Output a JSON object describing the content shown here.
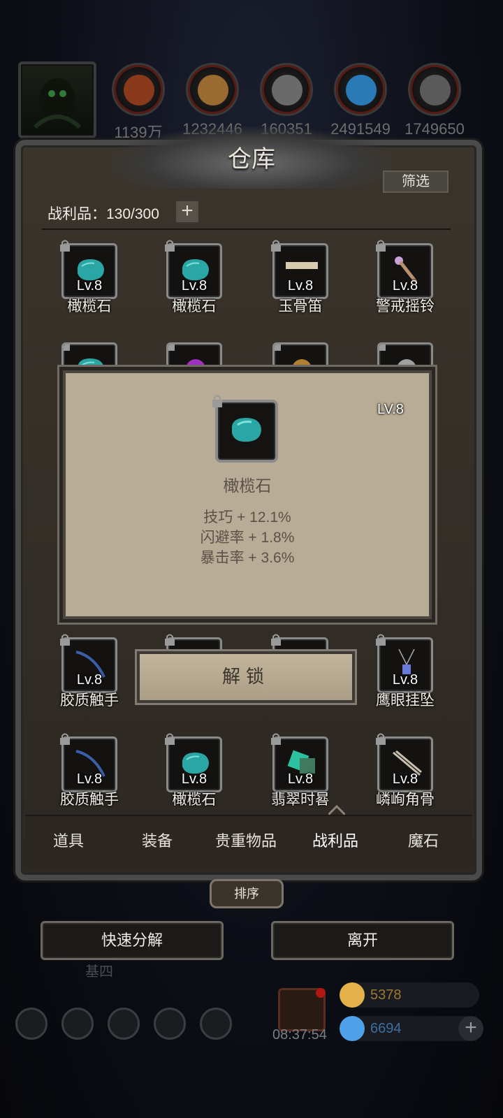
{
  "resources": [
    {
      "name": "copper-ore",
      "count": "1139万",
      "color": "#8a3a1a"
    },
    {
      "name": "wood-planks",
      "count": "1232446",
      "color": "#9a6a30"
    },
    {
      "name": "stone-blocks",
      "count": "160351",
      "color": "#6a6a6a"
    },
    {
      "name": "blue-crystal",
      "count": "2491549",
      "color": "#2a7ab8"
    },
    {
      "name": "iron-ingots",
      "count": "1749650",
      "color": "#5a5a5a"
    }
  ],
  "window": {
    "title": "仓库",
    "filter_label": "筛选"
  },
  "capacity": {
    "label": "战利品：130/300",
    "plus": "+"
  },
  "items": [
    {
      "name": "橄榄石",
      "level": "Lv.8",
      "art": "olivine"
    },
    {
      "name": "橄榄石",
      "level": "Lv.8",
      "art": "olivine"
    },
    {
      "name": "玉骨笛",
      "level": "Lv.8",
      "art": "bone-flute"
    },
    {
      "name": "警戒摇铃",
      "level": "Lv.8",
      "art": "bell"
    },
    {
      "name": "胶质触手",
      "level": "Lv.8",
      "art": "tentacle"
    },
    {
      "name": "",
      "level": "",
      "art": "fish-partial"
    },
    {
      "name": "",
      "level": "",
      "art": "hidden"
    },
    {
      "name": "鹰眼挂坠",
      "level": "Lv.8",
      "art": "pendant"
    },
    {
      "name": "胶质触手",
      "level": "Lv.8",
      "art": "tentacle"
    },
    {
      "name": "橄榄石",
      "level": "Lv.8",
      "art": "olivine"
    },
    {
      "name": "翡翠时晷",
      "level": "Lv.8",
      "art": "jade-clock"
    },
    {
      "name": "嶙峋角骨",
      "level": "Lv.8",
      "art": "horn-bone"
    }
  ],
  "partial_row": [
    {
      "art": "olivine"
    },
    {
      "art": "purple-gem"
    },
    {
      "art": "lantern"
    },
    {
      "art": "necklace"
    }
  ],
  "tooltip": {
    "name": "橄榄石",
    "level": "LV.8",
    "stats": [
      "技巧 + 12.1%",
      "闪避率 + 1.8%",
      "暴击率 + 3.6%"
    ]
  },
  "unlock_label": "解锁",
  "tabs": [
    "道具",
    "装备",
    "贵重物品",
    "战利品",
    "魔石"
  ],
  "active_tab": "战利品",
  "sort_label": "排序",
  "buttons": {
    "decompose": "快速分解",
    "leave": "离开"
  },
  "hud": {
    "timer": "08:37:54",
    "gold": "5378",
    "gems": "6694",
    "plus": "+",
    "behind_text": "基四"
  },
  "colors": {
    "gold": "#e2b14a",
    "gem": "#4ea0e8",
    "panel": "#3b342c",
    "tooltip_bg": "#b9ac96"
  }
}
